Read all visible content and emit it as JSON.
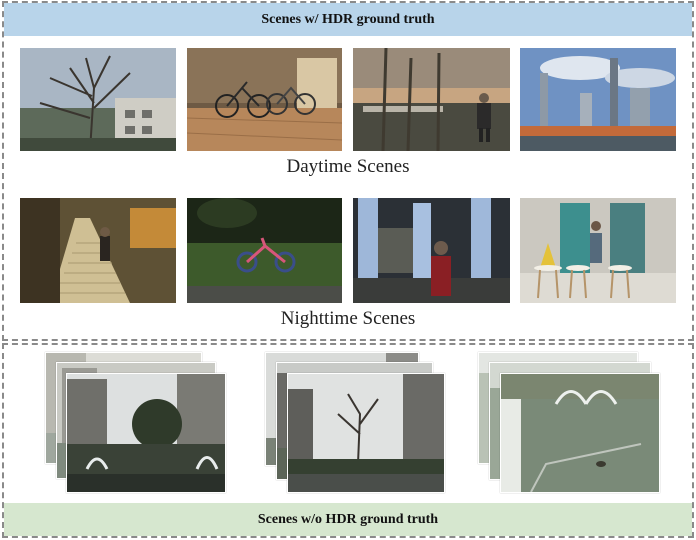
{
  "banners": {
    "top": "Scenes w/ HDR ground truth",
    "bottom": "Scenes w/o HDR ground truth"
  },
  "labels": {
    "day": "Daytime Scenes",
    "night": "Nighttime Scenes"
  },
  "colors": {
    "top_banner": "#b8d4ea",
    "bottom_banner": "#d6e7cf",
    "frame_border": "#8a8a8a"
  }
}
